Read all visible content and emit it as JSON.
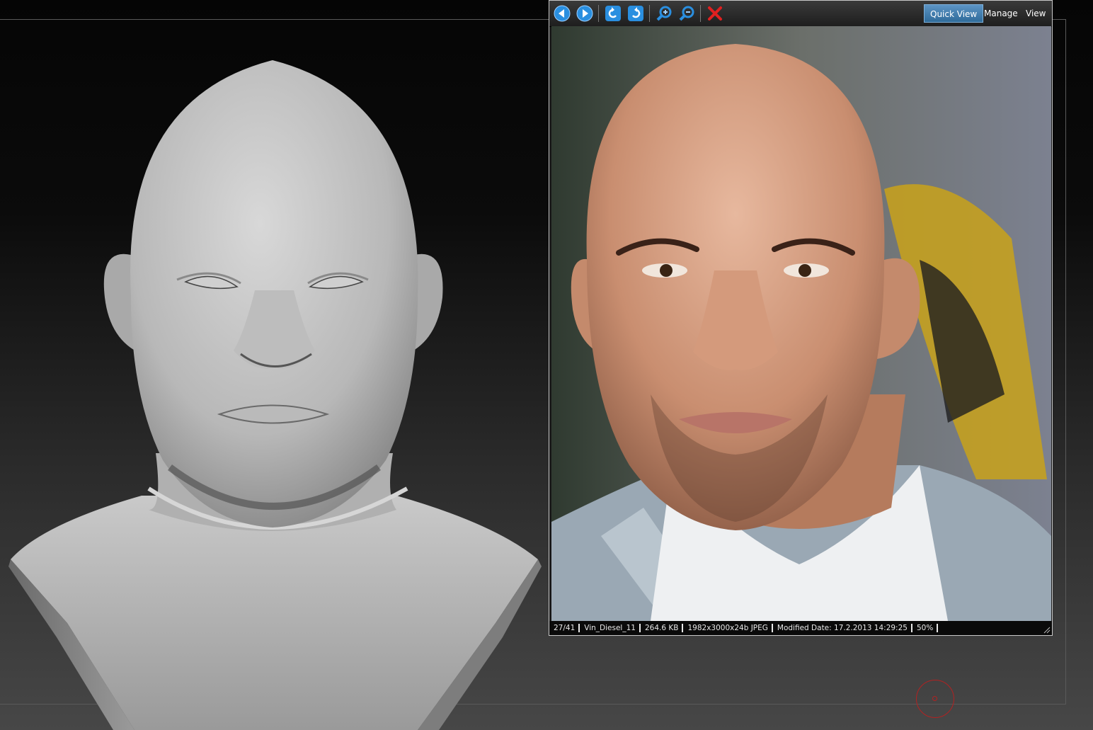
{
  "toolbar": {
    "icons": [
      "back-arrow-icon",
      "forward-arrow-icon",
      "rotate-left-icon",
      "rotate-right-icon",
      "zoom-in-icon",
      "zoom-out-icon",
      "close-icon"
    ],
    "tabs": [
      {
        "label": "Quick View",
        "active": true
      },
      {
        "label": "Manage",
        "active": false
      },
      {
        "label": "View",
        "active": false
      }
    ]
  },
  "statusbar": {
    "index": "27/41",
    "filename": "Vin_Diesel_11",
    "filesize": "264.6 KB",
    "dimensions": "1982x3000x24b JPEG",
    "modified": "Modified Date: 17.2.2013 14:29:25",
    "zoom": "50%"
  },
  "colors": {
    "accent": "#3b7fb8",
    "close_red": "#e02020",
    "icon_blue": "#2a8fe0",
    "brush_cursor": "#b22222"
  }
}
